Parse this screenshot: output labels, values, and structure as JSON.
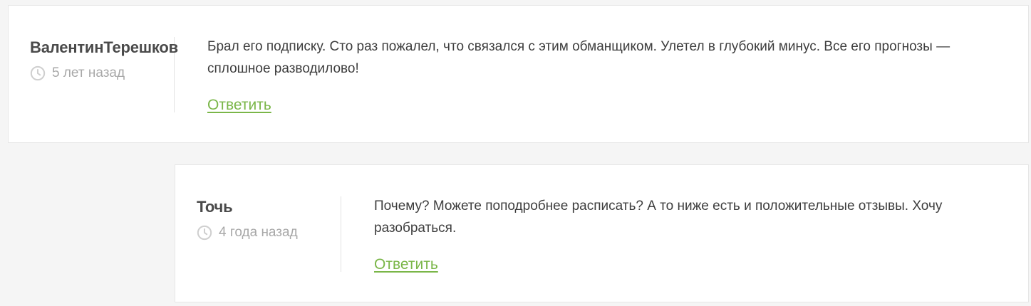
{
  "comments": [
    {
      "author": "ВалентинТерешков",
      "time": "5 лет назад",
      "text": "Брал его подписку. Сто раз пожалел, что связался с этим обманщиком. Улетел в глубокий минус. Все его прогнозы — сплошное разводилово!",
      "reply_label": "Ответить",
      "icon": "clock-icon"
    },
    {
      "author": "Точь",
      "time": "4 года назад",
      "text": "Почему? Можете поподробнее расписать? А то ниже есть и положительные отзывы. Хочу разобраться.",
      "reply_label": "Ответить",
      "icon": "clock-icon"
    }
  ],
  "colors": {
    "accent": "#7ab648",
    "background": "#f5f5f5",
    "card": "#ffffff",
    "author": "#4a4a4a",
    "muted": "#a8a8a8",
    "text": "#3d3d3d"
  }
}
